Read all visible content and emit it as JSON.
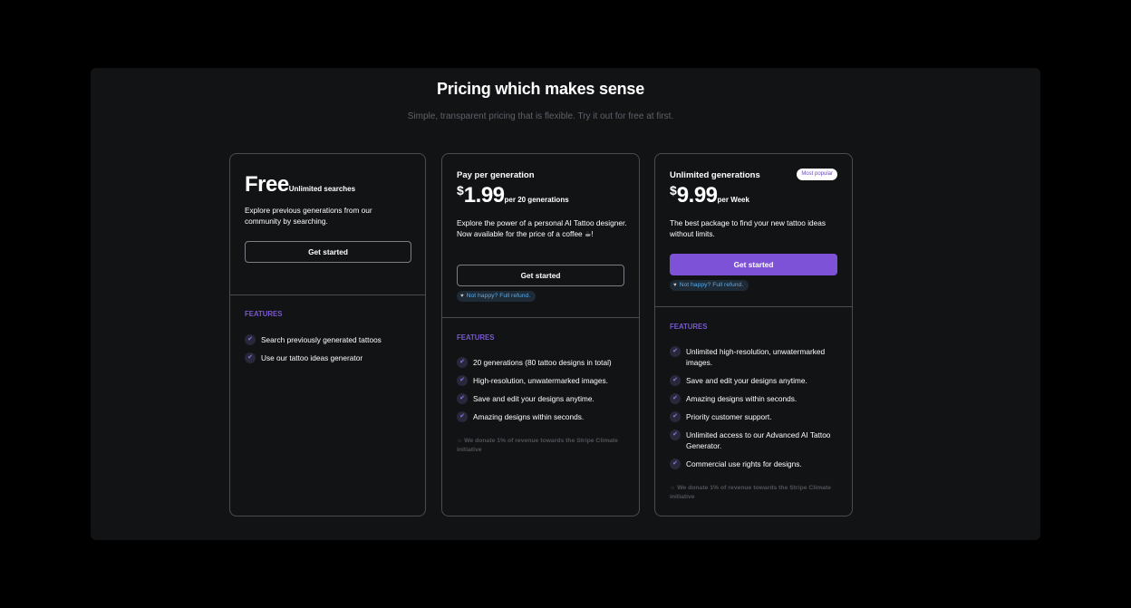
{
  "header": {
    "title": "Pricing which makes sense",
    "subtitle": "Simple, transparent pricing that is flexible. Try it out for free at first."
  },
  "plans": [
    {
      "name": "",
      "price": "Free",
      "unit": "Unlimited searches",
      "description": "Explore previous generations from our community by searching.",
      "cta": "Get started",
      "features_label": "FEATURES",
      "features": [
        "Search previously generated tattoos",
        "Use our tattoo ideas generator"
      ]
    },
    {
      "name": "Pay per generation",
      "currency": "$",
      "price": "1.99",
      "unit": "per 20 generations",
      "description": "Explore the power of a personal AI Tattoo designer. Now available for the price of a coffee ☕!",
      "cta": "Get started",
      "refund": "Not happy? Full refund.",
      "features_label": "FEATURES",
      "features": [
        "20 generations (80 tattoo designs in total)",
        "High-resolution, unwatermarked images.",
        "Save and edit your designs anytime.",
        "Amazing designs within seconds."
      ],
      "donate": "We donate 1% of revenue towards the Stripe Climate initiative"
    },
    {
      "name": "Unlimited generations",
      "badge": "Most popular",
      "currency": "$",
      "price": "9.99",
      "unit": "per Week",
      "description": "The best package to find your new tattoo ideas without limits.",
      "cta": "Get started",
      "refund": "Not happy? Full refund.",
      "features_label": "FEATURES",
      "features": [
        "Unlimited high-resolution, unwatermarked images.",
        "Save and edit your designs anytime.",
        "Amazing designs within seconds.",
        "Priority customer support.",
        "Unlimited access to our Advanced AI Tattoo Generator.",
        "Commercial use rights for designs."
      ],
      "donate": "We donate 1% of revenue towards the Stripe Climate initiative"
    }
  ],
  "icons": {
    "check": "check-icon",
    "heart": "heart-icon",
    "leaf": "leaf-icon"
  },
  "colors": {
    "accent": "#7e52d6",
    "background": "#000000",
    "panel": "#121315",
    "refund_text": "#5aa9e6"
  }
}
